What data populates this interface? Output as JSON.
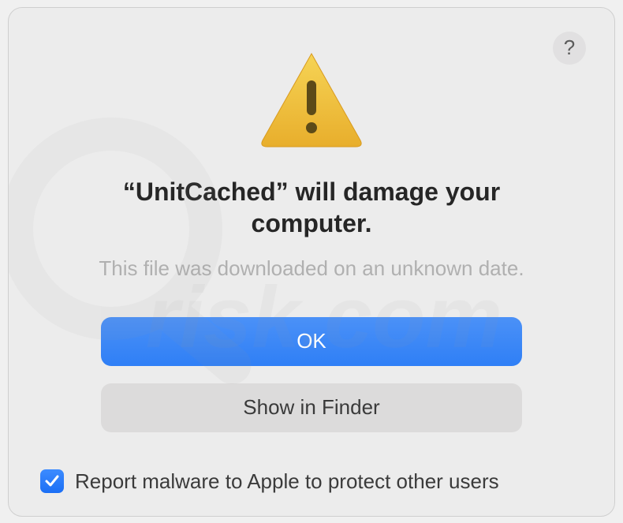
{
  "dialog": {
    "heading": "“UnitCached” will damage your computer.",
    "subtext": "This file was downloaded on an unknown date.",
    "primary_button": "OK",
    "secondary_button": "Show in Finder",
    "help_tooltip": "?",
    "checkbox": {
      "checked": true,
      "label": "Report malware to Apple to protect other users"
    }
  },
  "colors": {
    "primary_blue": "#2f7ff6",
    "dialog_bg": "#ececec",
    "subtext_gray": "#b0b0b0"
  }
}
